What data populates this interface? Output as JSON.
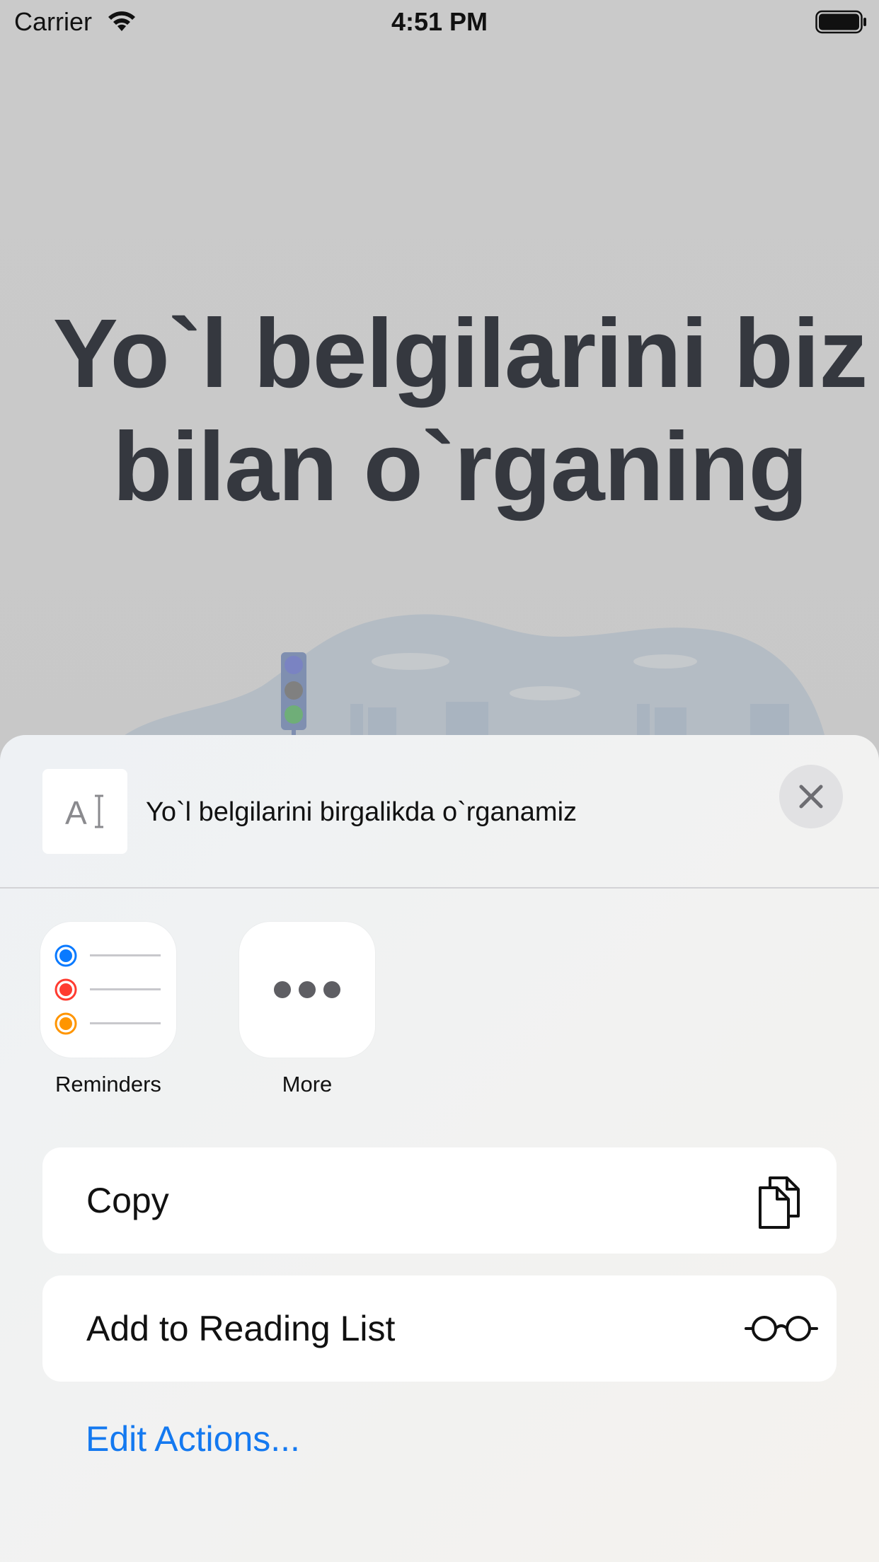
{
  "status_bar": {
    "carrier": "Carrier",
    "time": "4:51 PM"
  },
  "background_app": {
    "headline_line1": "Yo`l belgilarini biz",
    "headline_line2": "bilan o`rganing"
  },
  "share_sheet": {
    "title": "Yo`l belgilarini birgalikda o`rganamiz",
    "apps": [
      {
        "label": "Reminders",
        "icon": "reminders-icon"
      },
      {
        "label": "More",
        "icon": "more-icon"
      }
    ],
    "actions": [
      {
        "label": "Copy",
        "icon": "copy-icon"
      },
      {
        "label": "Add to Reading List",
        "icon": "glasses-icon"
      }
    ],
    "edit_actions_label": "Edit Actions...",
    "colors": {
      "link": "#1479f0",
      "reminder_blue": "#0a7aff",
      "reminder_red": "#ff3b30",
      "reminder_orange": "#ff9500"
    }
  }
}
